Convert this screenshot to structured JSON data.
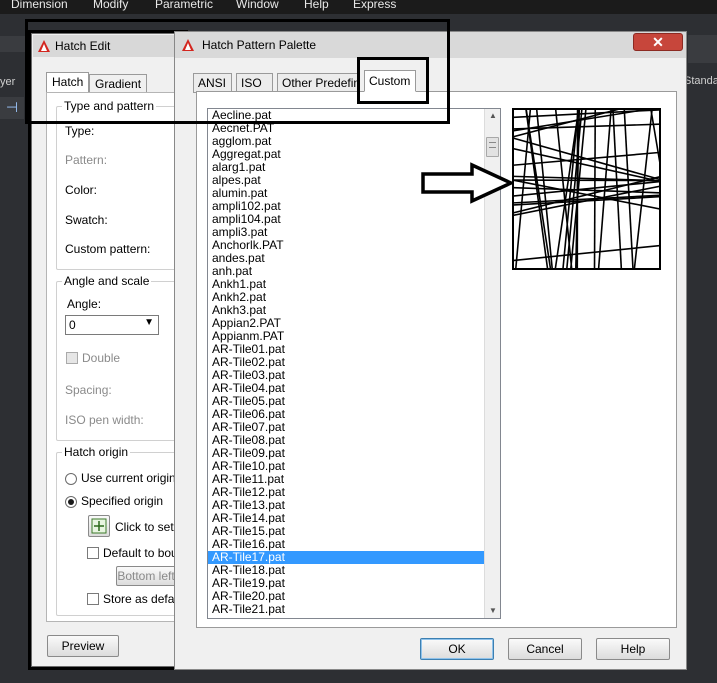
{
  "menubar": {
    "items": [
      "Dimension",
      "Modify",
      "Parametric",
      "Window",
      "Help",
      "Express"
    ]
  },
  "background": {
    "left_fragment": "yer",
    "right_fragment": "Standa"
  },
  "hatch_edit": {
    "title": "Hatch Edit",
    "tabs": [
      "Hatch",
      "Gradient"
    ],
    "type_and_pattern": {
      "title": "Type and pattern",
      "type_label": "Type:",
      "pattern_label": "Pattern:",
      "color_label": "Color:",
      "swatch_label": "Swatch:",
      "custom_pattern_label": "Custom pattern:"
    },
    "angle_and_scale": {
      "title": "Angle and scale",
      "angle_label": "Angle:",
      "angle_value": "0",
      "double_label": "Double",
      "spacing_label": "Spacing:",
      "iso_pen_width_label": "ISO pen width:"
    },
    "hatch_origin": {
      "title": "Hatch origin",
      "use_current_origin": "Use current origin",
      "specified_origin": "Specified origin",
      "click_to_set": "Click to set n",
      "default_to_boundary": "Default to boun",
      "bottom_left": "Bottom left",
      "store_as_default": "Store as defaul"
    },
    "preview_button": "Preview"
  },
  "palette": {
    "title": "Hatch Pattern Palette",
    "close_glyph": "✕",
    "tabs": [
      "ANSI",
      "ISO",
      "Other Predefined",
      "Custom"
    ],
    "active_tab": "Custom",
    "selected_item": "AR-Tile17.pat",
    "files": [
      "Aecline.pat",
      "Aecnet.PAT",
      "agglom.pat",
      "Aggregat.pat",
      "alarg1.pat",
      "alpes.pat",
      "alumin.pat",
      "ampli102.pat",
      "ampli104.pat",
      "ampli3.pat",
      "Anchorlk.PAT",
      "andes.pat",
      "anh.pat",
      "Ankh1.pat",
      "Ankh2.pat",
      "Ankh3.pat",
      "Appian2.PAT",
      "Appianm.PAT",
      "AR-Tile01.pat",
      "AR-Tile02.pat",
      "AR-Tile03.pat",
      "AR-Tile04.pat",
      "AR-Tile05.pat",
      "AR-Tile06.pat",
      "AR-Tile07.pat",
      "AR-Tile08.pat",
      "AR-Tile09.pat",
      "AR-Tile10.pat",
      "AR-Tile11.pat",
      "AR-Tile12.pat",
      "AR-Tile13.pat",
      "AR-Tile14.pat",
      "AR-Tile15.pat",
      "AR-Tile16.pat",
      "AR-Tile17.pat",
      "AR-Tile18.pat",
      "AR-Tile19.pat",
      "AR-Tile20.pat",
      "AR-Tile21.pat"
    ],
    "ok_button": "OK",
    "cancel_button": "Cancel",
    "help_button": "Help"
  },
  "colors": {
    "selection": "#3399ff",
    "close_button": "#c7463b",
    "annotation": "#000000"
  },
  "icons": {
    "app_logo": "autocad-logo-icon",
    "annotation_arrow": "right-arrow-icon",
    "pick_point": "pick-point-icon",
    "dropdown": "chevron-down-icon"
  }
}
